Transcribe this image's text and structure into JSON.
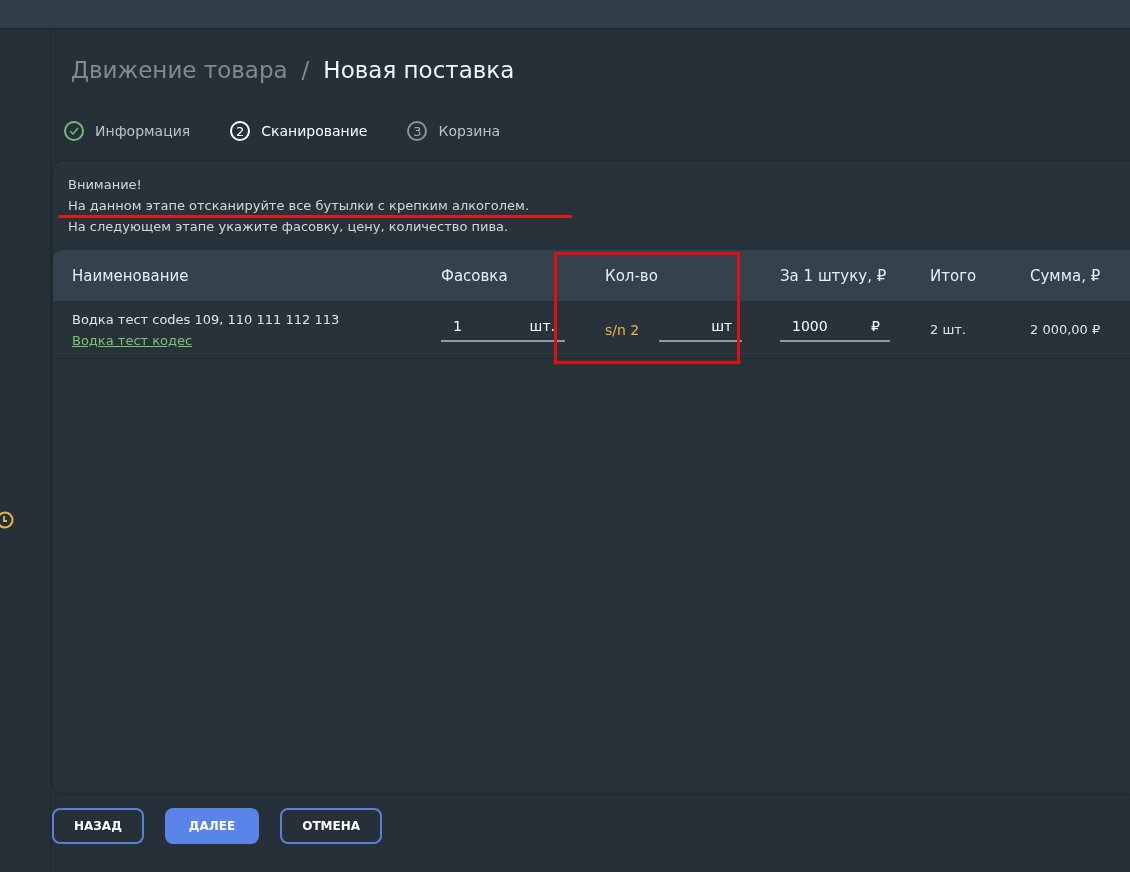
{
  "breadcrumb": {
    "parent": "Движение товара",
    "separator": "/",
    "current": "Новая поставка"
  },
  "steps": [
    {
      "label": "Информация",
      "done": true,
      "selected": false
    },
    {
      "number": "2",
      "label": "Сканирование",
      "done": false,
      "selected": true
    },
    {
      "number": "3",
      "label": "Корзина",
      "done": false,
      "selected": false
    }
  ],
  "notice": [
    "Внимание!",
    "На данном этапе отсканируйте все бутылки с крепким алкоголем.",
    "На следующем этапе укажите фасовку, цену, количество пива."
  ],
  "table": {
    "columns": [
      "Наименование",
      "Фасовка",
      "Кол-во",
      "За 1 штуку, ₽",
      "Итого",
      "Сумма, ₽"
    ],
    "rows": [
      {
        "name": "Водка тест codes 109, 110 111 112 113",
        "link": "Водка тест кодес",
        "packing": {
          "value": "1",
          "unit": "шт."
        },
        "quantity": {
          "serial": "s/n 2",
          "unit": "шт"
        },
        "price": {
          "value": "1000",
          "unit": "₽"
        },
        "total": "2 шт.",
        "sum": "2 000,00 ₽"
      }
    ]
  },
  "buttons": [
    {
      "label": "НАЗАД",
      "kind": "outline"
    },
    {
      "label": "ДАЛЕЕ",
      "kind": "primary"
    },
    {
      "label": "ОТМЕНА",
      "kind": "outline"
    }
  ]
}
